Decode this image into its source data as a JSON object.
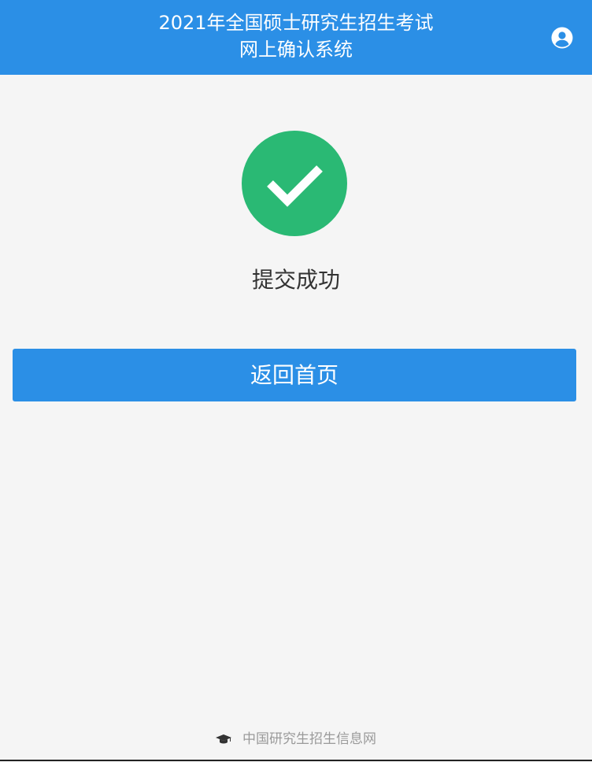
{
  "header": {
    "title_line1": "2021年全国硕士研究生招生考试",
    "title_line2": "网上确认系统",
    "user_icon": "user-circle-icon"
  },
  "main": {
    "status_icon": "checkmark-circle-icon",
    "status_text": "提交成功",
    "home_button_label": "返回首页"
  },
  "footer": {
    "icon": "graduation-cap-icon",
    "link_text": "中国研究生招生信息网"
  },
  "colors": {
    "primary": "#2b8fe6",
    "success": "#2ab974",
    "background": "#f5f5f5",
    "text": "#333333",
    "footer_text": "#9a9a9a"
  }
}
